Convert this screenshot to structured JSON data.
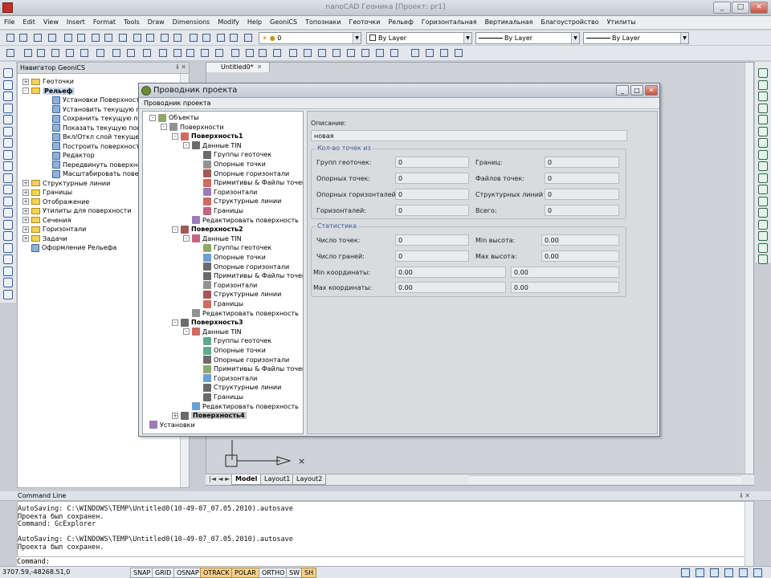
{
  "window": {
    "title": "nanoCAD Геоника [Проект: pr1]"
  },
  "menu": [
    "File",
    "Edit",
    "View",
    "Insert",
    "Format",
    "Tools",
    "Draw",
    "Dimensions",
    "Modify",
    "Help",
    "GeoniCS",
    "Топознаки",
    "Геоточки",
    "Рельеф",
    "Горизонтальная",
    "Вертикальная",
    "Благоустройство",
    "Утилиты"
  ],
  "toolbar": {
    "layer_combo": "0",
    "color_combo": "By Layer",
    "linetype_combo": "By Layer",
    "lineweight_combo": "By Layer"
  },
  "navigator": {
    "title": "Навигатор GeoniCS",
    "items": [
      {
        "label": "Геоточки",
        "level": 0,
        "exp": "+",
        "icon": "folder"
      },
      {
        "label": "Рельеф",
        "level": 0,
        "exp": "-",
        "icon": "folder",
        "bold": true,
        "selected": true
      },
      {
        "label": "Установки Поверхностей",
        "level": 1,
        "icon": "tool"
      },
      {
        "label": "Установить текущую повер",
        "level": 1,
        "icon": "tool"
      },
      {
        "label": "Сохранить текущую поверх",
        "level": 1,
        "icon": "tool"
      },
      {
        "label": "Показать текущую поверхн",
        "level": 1,
        "icon": "tool"
      },
      {
        "label": "Вкл/Откл слой текущей по",
        "level": 1,
        "icon": "tool"
      },
      {
        "label": "Построить поверхность",
        "level": 1,
        "icon": "tool"
      },
      {
        "label": "Редактор",
        "level": 1,
        "icon": "tool"
      },
      {
        "label": "Передвинуть поверхность",
        "level": 1,
        "icon": "tool"
      },
      {
        "label": "Масштабировать поверхно",
        "level": 1,
        "icon": "tool"
      },
      {
        "label": "Структурные линии",
        "level": 0,
        "exp": "+",
        "icon": "folder"
      },
      {
        "label": "Границы",
        "level": 0,
        "exp": "+",
        "icon": "folder"
      },
      {
        "label": "Отображение",
        "level": 0,
        "exp": "+",
        "icon": "folder"
      },
      {
        "label": "Утилиты для поверхности",
        "level": 0,
        "exp": "+",
        "icon": "folder"
      },
      {
        "label": "Сечения",
        "level": 0,
        "exp": "+",
        "icon": "folder"
      },
      {
        "label": "Горизонтали",
        "level": 0,
        "exp": "+",
        "icon": "folder"
      },
      {
        "label": "Задачи",
        "level": 0,
        "exp": "+",
        "icon": "folder"
      },
      {
        "label": "Оформление Рельефа",
        "level": 0,
        "icon": "tool"
      }
    ]
  },
  "drawing": {
    "tab": "Untitled0*",
    "layout_tabs": [
      "Model",
      "Layout1",
      "Layout2"
    ]
  },
  "dialog": {
    "title": "Проводник проекта",
    "subtitle": "Проводник проекта",
    "tree": [
      {
        "label": "Объекты",
        "level": 0,
        "exp": "-"
      },
      {
        "label": "Поверхности",
        "level": 1,
        "exp": "-"
      },
      {
        "label": "Поверхность1",
        "level": 2,
        "exp": "-",
        "bold": true
      },
      {
        "label": "Данные TIN",
        "level": 3,
        "exp": "-"
      },
      {
        "label": "Группы геоточек",
        "level": 4
      },
      {
        "label": "Опорные точки",
        "level": 4
      },
      {
        "label": "Опорные горизонтали",
        "level": 4
      },
      {
        "label": "Примитивы & Файлы точек",
        "level": 4
      },
      {
        "label": "Горизонтали",
        "level": 4
      },
      {
        "label": "Структурные линии",
        "level": 4
      },
      {
        "label": "Границы",
        "level": 4
      },
      {
        "label": "Редактировать поверхность",
        "level": 3
      },
      {
        "label": "Поверхность2",
        "level": 2,
        "exp": "-",
        "bold": true
      },
      {
        "label": "Данные TIN",
        "level": 3,
        "exp": "-"
      },
      {
        "label": "Группы геоточек",
        "level": 4
      },
      {
        "label": "Опорные точки",
        "level": 4
      },
      {
        "label": "Опорные горизонтали",
        "level": 4
      },
      {
        "label": "Примитивы & Файлы точек",
        "level": 4
      },
      {
        "label": "Горизонтали",
        "level": 4
      },
      {
        "label": "Структурные линии",
        "level": 4
      },
      {
        "label": "Границы",
        "level": 4
      },
      {
        "label": "Редактировать поверхность",
        "level": 3
      },
      {
        "label": "Поверхность3",
        "level": 2,
        "exp": "-",
        "bold": true
      },
      {
        "label": "Данные TIN",
        "level": 3,
        "exp": "-"
      },
      {
        "label": "Группы геоточек",
        "level": 4
      },
      {
        "label": "Опорные точки",
        "level": 4
      },
      {
        "label": "Опорные горизонтали",
        "level": 4
      },
      {
        "label": "Примитивы & Файлы точек",
        "level": 4
      },
      {
        "label": "Горизонтали",
        "level": 4
      },
      {
        "label": "Структурные линии",
        "level": 4
      },
      {
        "label": "Границы",
        "level": 4
      },
      {
        "label": "Редактировать поверхность",
        "level": 3
      },
      {
        "label": "Поверхность4",
        "level": 2,
        "exp": "+",
        "bold": true,
        "selected": true
      },
      {
        "label": "Установки",
        "level": 0
      }
    ],
    "description_label": "Описание:",
    "description_value": "новая",
    "points_group": {
      "title": "Кол-во точек из",
      "geopoint_groups": {
        "label": "Групп геоточек:",
        "value": "0"
      },
      "control_points": {
        "label": "Опорных точек:",
        "value": "0"
      },
      "control_contours": {
        "label": "Опорных горизонталей:",
        "value": "0"
      },
      "contours": {
        "label": "Горизонталей:",
        "value": "0"
      },
      "boundaries": {
        "label": "Границ:",
        "value": "0"
      },
      "point_files": {
        "label": "Файлов точек:",
        "value": "0"
      },
      "breaklines": {
        "label": "Структурных линий",
        "value": "0"
      },
      "total": {
        "label": "Всего:",
        "value": "0"
      }
    },
    "stats_group": {
      "title": "Статистика",
      "num_points": {
        "label": "Число точек:",
        "value": "0"
      },
      "num_faces": {
        "label": "Число граней:",
        "value": "0"
      },
      "min_height": {
        "label": "Min высота:",
        "value": "0.00"
      },
      "max_height": {
        "label": "Max высота:",
        "value": "0.00"
      },
      "min_coords": {
        "label": "Min координаты:",
        "x": "0.00",
        "y": "0.00"
      },
      "max_coords": {
        "label": "Max координаты:",
        "x": "0.00",
        "y": "0.00"
      }
    }
  },
  "command": {
    "title": "Command Line",
    "lines": [
      "AutoSaving: C:\\WINDOWS\\TEMP\\Untitled0(10-49-07_07.05.2010).autosave",
      "Проекта был сохранен.",
      "Command: GcExplorer",
      "",
      "AutoSaving: C:\\WINDOWS\\TEMP\\Untitled0(10-49-07_07.05.2010).autosave",
      "Проекта был сохранен."
    ],
    "prompt": "Command:"
  },
  "status": {
    "coords": "3707.59,-48268.51,0",
    "buttons": [
      {
        "label": "SNAP",
        "on": false
      },
      {
        "label": "GRID",
        "on": false
      },
      {
        "label": "OSNAP",
        "on": false
      },
      {
        "label": "OTRACK",
        "on": true
      },
      {
        "label": "POLAR",
        "on": true
      },
      {
        "label": "ORTHO",
        "on": false
      },
      {
        "label": "SW",
        "on": false
      },
      {
        "label": "SH",
        "on": true
      }
    ]
  }
}
